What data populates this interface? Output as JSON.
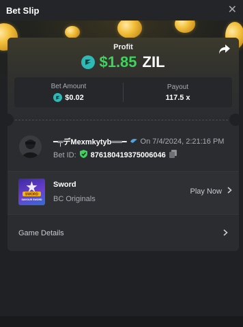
{
  "header": {
    "title": "Bet Slip",
    "close_icon": "close-icon"
  },
  "profit": {
    "label": "Profit",
    "amount": "$1.85",
    "currency": "ZIL",
    "currency_icon": "zil-coin-icon",
    "amount_color": "#3ed35c",
    "share_icon": "share-icon"
  },
  "stats": {
    "bet_amount_label": "Bet Amount",
    "bet_amount_value": "$0.02",
    "payout_label": "Payout",
    "payout_value": "117.5 x"
  },
  "bet": {
    "username": "━╤デMexmkytyb══━",
    "date_text": "On 7/4/2024, 2:21:16 PM",
    "bet_id_label": "Bet ID:",
    "bet_id_value": "876180419375006046",
    "verified_icon": "shield-check-icon",
    "copy_icon": "copy-icon"
  },
  "game": {
    "name": "Sword",
    "provider": "BC Originals",
    "action_label": "Play Now",
    "thumb_text": "SWORD",
    "thumb_subtext": "SAVIOUR SWORD"
  },
  "details": {
    "label": "Game Details"
  },
  "colors": {
    "background": "#1f2124",
    "card": "#2a2c30",
    "accent_green": "#3ed35c",
    "zil_teal": "#2fb9b6"
  }
}
